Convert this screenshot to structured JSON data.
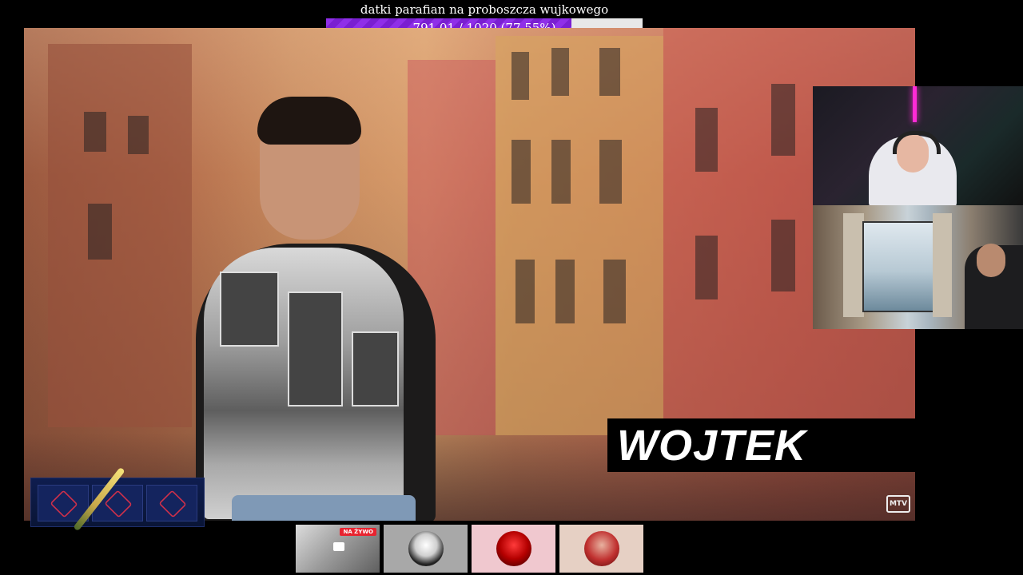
{
  "goal": {
    "title": "datki parafian na proboszcza wujkowego",
    "progress_text": "791.01 / 1020 (77.55%)",
    "progress_percent": 77.55
  },
  "overlay": {
    "name_label": "WOJTEK",
    "channel_logo": "MTV"
  },
  "webcams": {
    "top": "streamer-camera",
    "bottom": "guest-camera"
  },
  "game_widget": {
    "icons": [
      "rifle-skin-icon",
      "case-icon",
      "sniper-skin-icon",
      "knife-icon"
    ]
  },
  "thumbnails": [
    {
      "badge": "NA ŻYWO",
      "icon": "stream-preview"
    },
    {
      "icon": "car-avatar-icon"
    },
    {
      "icon": "red-logo-avatar-icon"
    },
    {
      "icon": "person-avatar-icon"
    }
  ],
  "colors": {
    "accent": "#8f2fe8",
    "live_badge": "#e8232f",
    "name_box_bg": "#000000"
  }
}
